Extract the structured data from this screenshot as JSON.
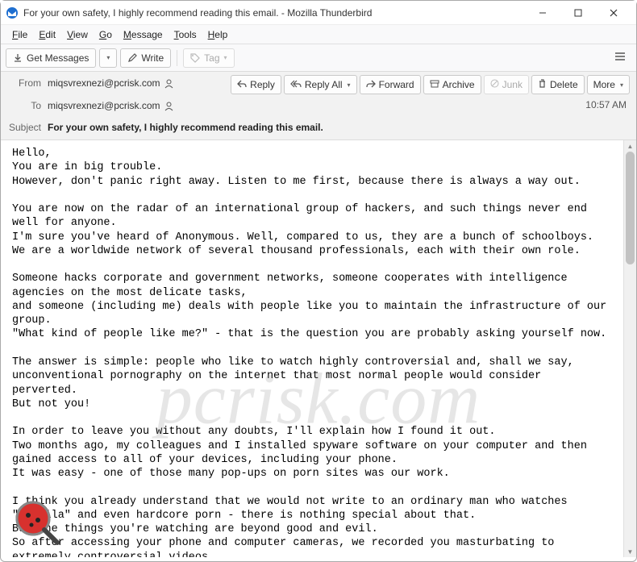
{
  "window": {
    "title": "For your own safety, I highly recommend reading this email. - Mozilla Thunderbird"
  },
  "menu": {
    "file": "File",
    "edit": "Edit",
    "view": "View",
    "go": "Go",
    "message": "Message",
    "tools": "Tools",
    "help": "Help"
  },
  "toolbar": {
    "get_messages": "Get Messages",
    "write": "Write",
    "tag": "Tag"
  },
  "actions": {
    "reply": "Reply",
    "reply_all": "Reply All",
    "forward": "Forward",
    "archive": "Archive",
    "junk": "Junk",
    "delete": "Delete",
    "more": "More"
  },
  "headers": {
    "from_label": "From",
    "from_value": "miqsvrexnezi@pcrisk.com",
    "to_label": "To",
    "to_value": "miqsvrexnezi@pcrisk.com",
    "subject_label": "Subject",
    "subject_value": "For your own safety, I highly recommend reading this email.",
    "time": "10:57 AM"
  },
  "body": "Hello,\nYou are in big trouble.\nHowever, don't panic right away. Listen to me first, because there is always a way out.\n\nYou are now on the radar of an international group of hackers, and such things never end well for anyone.\nI'm sure you've heard of Anonymous. Well, compared to us, they are a bunch of schoolboys.\nWe are a worldwide network of several thousand professionals, each with their own role.\n\nSomeone hacks corporate and government networks, someone cooperates with intelligence agencies on the most delicate tasks,\nand someone (including me) deals with people like you to maintain the infrastructure of our group.\n\"What kind of people like me?\" - that is the question you are probably asking yourself now.\n\nThe answer is simple: people who like to watch highly controversial and, shall we say, unconventional pornography on the internet that most normal people would consider perverted.\nBut not you!\n\nIn order to leave you without any doubts, I'll explain how I found it out.\nTwo months ago, my colleagues and I installed spyware software on your computer and then gained access to all of your devices, including your phone.\nIt was easy - one of those many pop-ups on porn sites was our work.\n\nI think you already understand that we would not write to an ordinary man who watches \"vanilla\" and even hardcore porn - there is nothing special about that.\nBut the things you're watching are beyond good and evil.\nSo after accessing your phone and computer cameras, we recorded you masturbating to extremely controversial videos.",
  "watermark": "pcrisk.com"
}
